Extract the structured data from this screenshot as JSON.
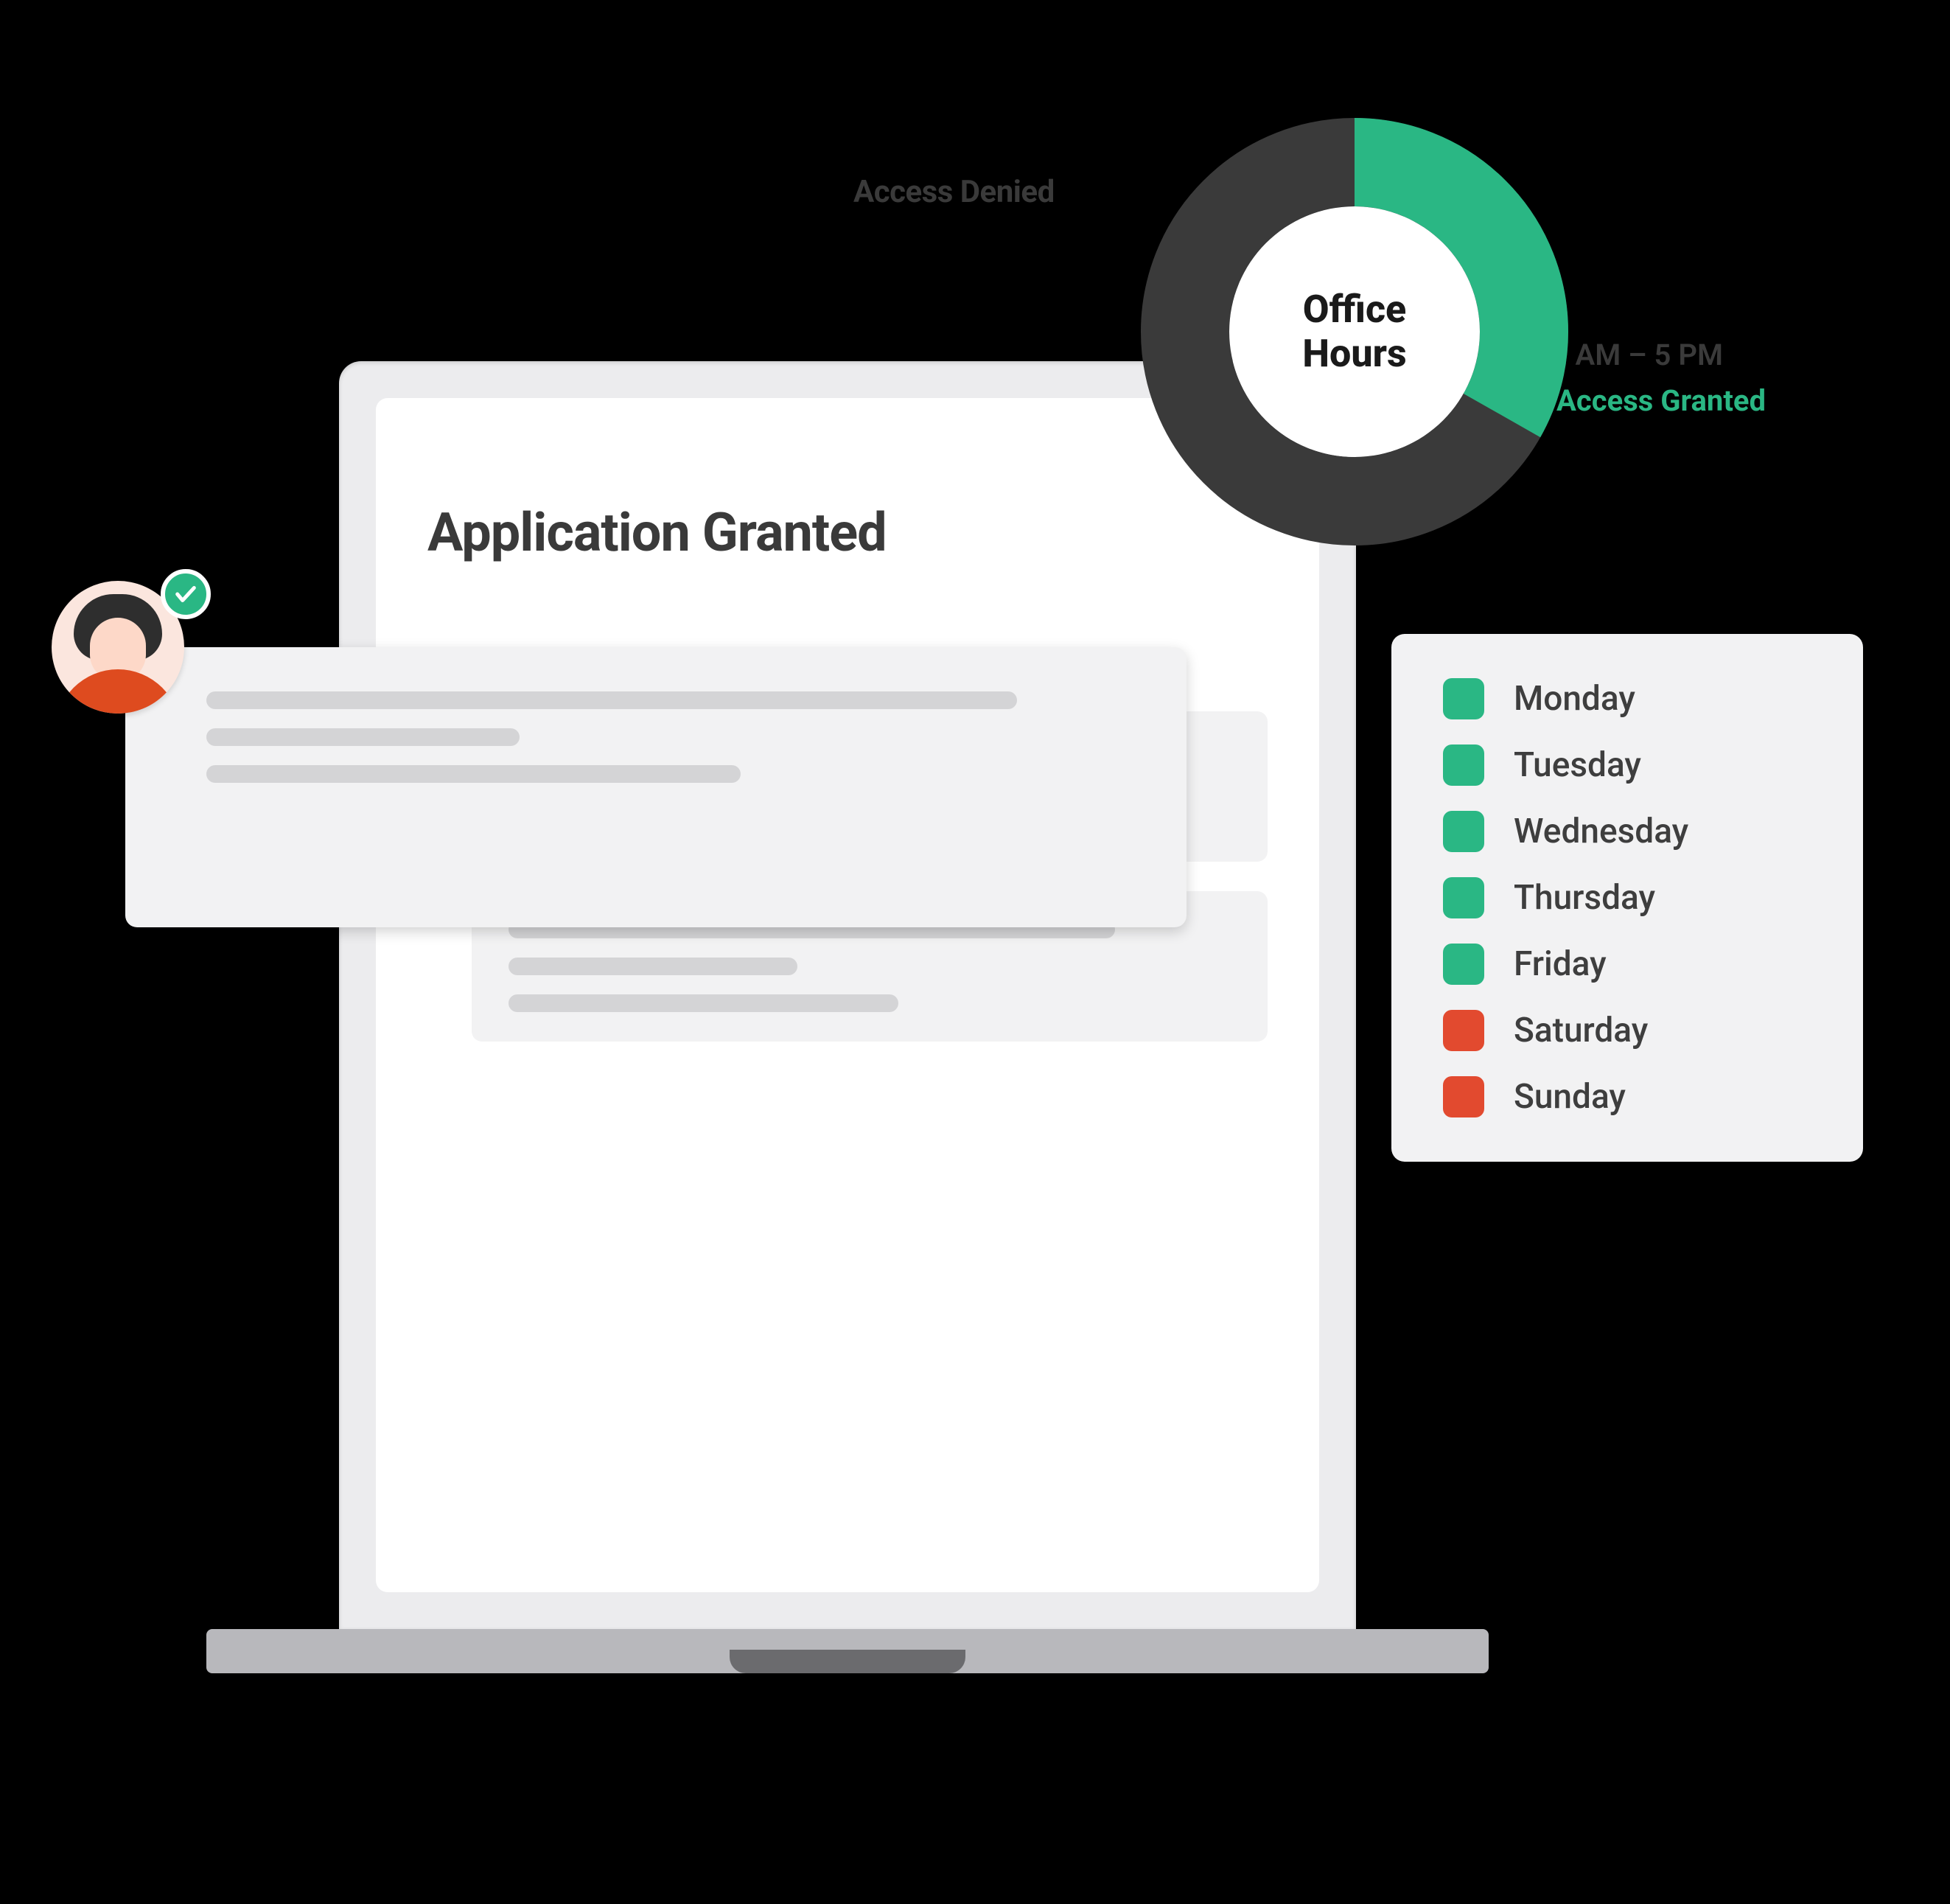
{
  "page": {
    "title": "Application Granted"
  },
  "donut": {
    "center_label_line1": "Office",
    "center_label_line2": "Hours",
    "denied_label": "Access Denied",
    "granted_label": "Access Granted",
    "time_range": "9 AM – 5 PM"
  },
  "days": [
    {
      "label": "Monday",
      "active": true
    },
    {
      "label": "Tuesday",
      "active": true
    },
    {
      "label": "Wednesday",
      "active": true
    },
    {
      "label": "Thursday",
      "active": true
    },
    {
      "label": "Friday",
      "active": true
    },
    {
      "label": "Saturday",
      "active": false
    },
    {
      "label": "Sunday",
      "active": false
    }
  ],
  "colors": {
    "accent_green": "#2ab784",
    "accent_red": "#e24a2f",
    "ring_dark": "#3a3a3a"
  },
  "chart_data": {
    "type": "pie",
    "title": "Office Hours",
    "series": [
      {
        "name": "Access Granted",
        "value": 33,
        "color": "#2ab784",
        "note": "9 AM – 5 PM"
      },
      {
        "name": "Access Denied",
        "value": 67,
        "color": "#3a3a3a"
      }
    ]
  }
}
